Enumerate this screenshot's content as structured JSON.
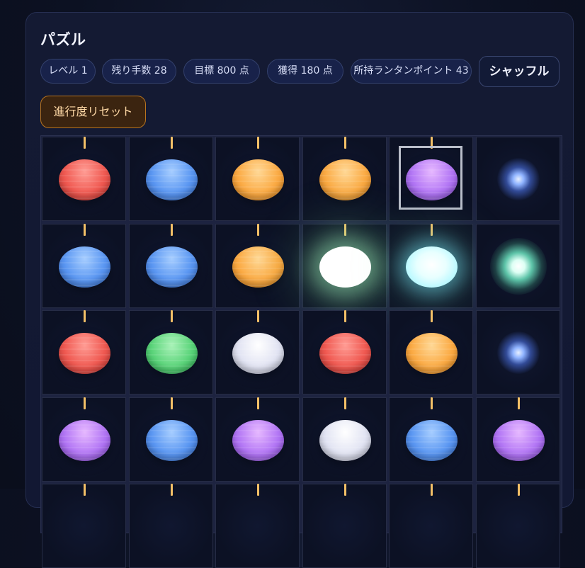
{
  "panel": {
    "title": "パズル"
  },
  "stats": [
    {
      "label": "レベル 1"
    },
    {
      "label": "残り手数 28"
    },
    {
      "label": "目標 800 点"
    },
    {
      "label": "獲得 180 点"
    },
    {
      "label": "所持ランタンポイント 43"
    }
  ],
  "buttons": {
    "shuffle": "シャッフル",
    "reset": "進行度リセット"
  },
  "board": {
    "selected": {
      "row": 0,
      "col": 4
    },
    "rows": [
      [
        "red",
        "blue",
        "orange",
        "orange",
        "purple",
        "glow-blue"
      ],
      [
        "blue",
        "blue",
        "orange",
        "lit-white",
        "lit-cyan",
        "glow-green"
      ],
      [
        "red",
        "green",
        "white",
        "red",
        "orange",
        "glow-blue"
      ],
      [
        "purple",
        "blue",
        "purple",
        "white",
        "blue",
        "purple"
      ],
      [
        "",
        "",
        "",
        "",
        "",
        ""
      ]
    ]
  },
  "colors": {
    "red": "#f05a52",
    "blue": "#5b97f2",
    "orange": "#fbab45",
    "purple": "#b377f5",
    "green": "#5bd47a",
    "white": "#e2e4f3",
    "string": "#f3c067",
    "accent_reset": "#b87420"
  }
}
